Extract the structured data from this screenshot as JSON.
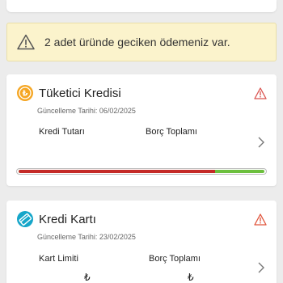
{
  "alert": {
    "icon": "warning-triangle-icon",
    "text": "2 adet üründe geciken ödemeniz var.",
    "background": "#fbf3cc"
  },
  "consumer_loan": {
    "icon": "lira-coin-icon",
    "icon_color": "#f5a623",
    "title": "Tüketici Kredisi",
    "date_text": "Güncelleme Tarihi: 06/02/2025",
    "col1_label": "Kredi Tutarı",
    "col2_label": "Borç Toplamı",
    "warning_icon": "warning-triangle-icon",
    "warning_color": "#d9534f",
    "progress_fraction": 0.8,
    "progress_colors": {
      "paid": "#c42a27",
      "remaining": "#6cbf3d"
    }
  },
  "credit_card": {
    "icon": "credit-card-icon",
    "icon_color": "#16a6c9",
    "title": "Kredi Kartı",
    "date_text": "Güncelleme Tarihi: 23/02/2025",
    "col1_label": "Kart Limiti",
    "col2_label": "Borç Toplamı",
    "col1_value": "₺",
    "col2_value": "₺",
    "warning_icon": "warning-triangle-icon",
    "warning_color": "#e0533a"
  }
}
